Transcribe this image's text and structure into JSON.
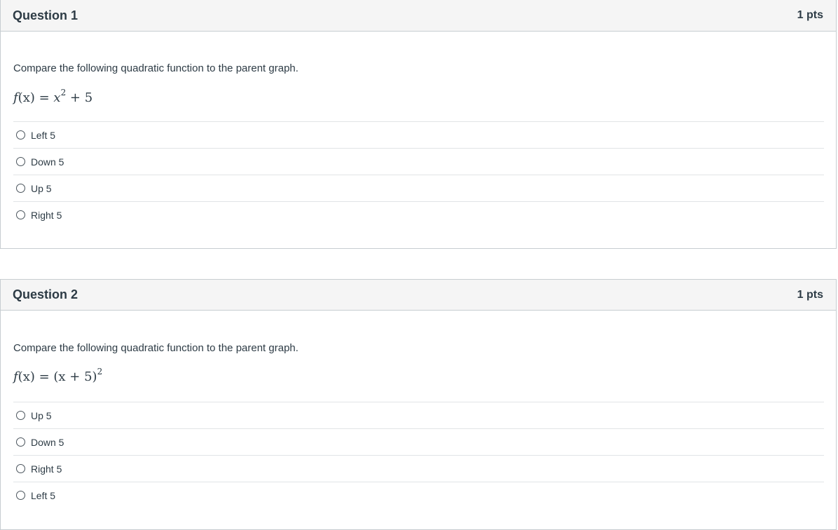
{
  "questions": [
    {
      "title": "Question 1",
      "points": "1 pts",
      "prompt": "Compare the following quadratic function to the parent graph.",
      "formula": {
        "lhs_f": "f",
        "lhs_rest": "(x) = ",
        "rhs_base": "x",
        "rhs_exp": "2",
        "rhs_tail": " + 5"
      },
      "answers": [
        "Left 5",
        "Down 5",
        "Up 5",
        "Right 5"
      ]
    },
    {
      "title": "Question 2",
      "points": "1 pts",
      "prompt": "Compare the following quadratic function to the parent graph.",
      "formula": {
        "lhs_f": "f",
        "lhs_rest": "(x) = ",
        "rhs_base": "(x + 5)",
        "rhs_exp": "2",
        "rhs_tail": ""
      },
      "answers": [
        "Up 5",
        "Down 5",
        "Right 5",
        "Left 5"
      ]
    }
  ]
}
